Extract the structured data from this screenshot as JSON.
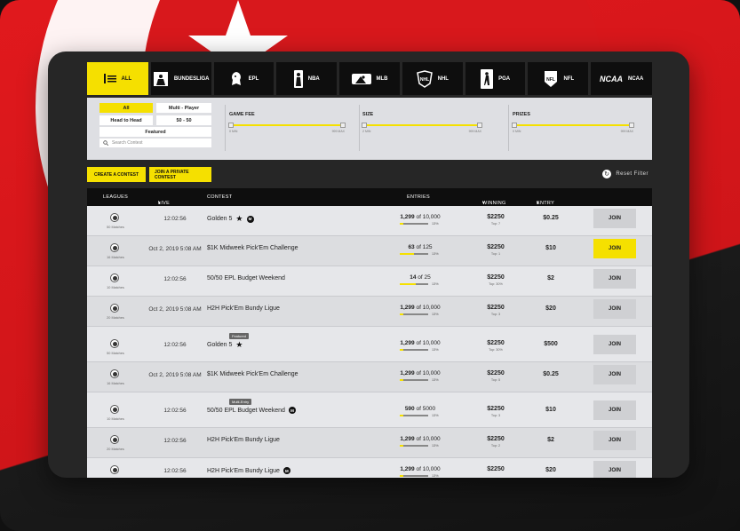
{
  "tabs": [
    {
      "label": "ALL",
      "active": true,
      "icon": "all-list-icon"
    },
    {
      "label": "BUNDESLIGA",
      "icon": "bundesliga-logo-icon"
    },
    {
      "label": "EPL",
      "icon": "epl-lion-icon"
    },
    {
      "label": "NBA",
      "icon": "nba-logo-icon"
    },
    {
      "label": "MLB",
      "icon": "mlb-logo-icon"
    },
    {
      "label": "NHL",
      "icon": "nhl-shield-icon"
    },
    {
      "label": "PGA",
      "icon": "pga-golfer-icon"
    },
    {
      "label": "NFL",
      "icon": "nfl-shield-icon"
    },
    {
      "label": "NCAA",
      "logo_text": "NCAA",
      "icon": "ncaa-logo-icon"
    }
  ],
  "filters": {
    "type_buttons": {
      "all": "All",
      "multi_player": "Multi - Player",
      "head_to_head": "Head to Head",
      "fifty_fifty": "50 - 50",
      "featured": "Featured"
    },
    "search_placeholder": "Search Contest",
    "game_fee": {
      "label": "GAME FEE",
      "lo": "0",
      "hi": "999",
      "lo_unit": "MIN",
      "hi_unit": "MAX",
      "range": [
        0,
        999
      ]
    },
    "size": {
      "label": "SIZE",
      "lo": "2",
      "hi": "999",
      "lo_unit": "MIN",
      "hi_unit": "MAX",
      "range": [
        2,
        999
      ]
    },
    "prizes": {
      "label": "PRIZES",
      "lo": "0",
      "hi": "999",
      "lo_unit": "MIN",
      "hi_unit": "MAX",
      "range": [
        0,
        999
      ]
    }
  },
  "actions": {
    "create": "CREATE A CONTEST",
    "private": "JOIN A PRIVATE CONTEST",
    "reset": "Reset Filter"
  },
  "columns": {
    "leagues": "LEAGUES",
    "live": "LIVE",
    "contest": "CONTEST",
    "entries": "ENTRIES",
    "winning": "WINNING",
    "entry_fee": "ENTRY FEE"
  },
  "rows": [
    {
      "matches": "50 Matches",
      "live": "12:02:56",
      "contest": "Golden 5",
      "star": true,
      "m": true,
      "entries_cur": "1,299",
      "entries_tot": "of 10,000",
      "pct": "13%",
      "fill": 0.13,
      "winning": "$2250",
      "top": "Top: 7",
      "fee": "$0.25",
      "join": "JOIN"
    },
    {
      "matches": "16 Matches",
      "live": "Oct 2, 2019 5:08 AM",
      "contest": "$1K Midweek Pick'Em Challenge",
      "entries_cur": "63",
      "entries_tot": "of 125",
      "pct": "13%",
      "fill": 0.5,
      "winning": "$2250",
      "top": "Top: 1",
      "fee": "$10",
      "join": "JOIN",
      "highlight": true
    },
    {
      "matches": "10 Matches",
      "live": "12:02:56",
      "contest": "50/50 EPL Budget Weekend",
      "entries_cur": "14",
      "entries_tot": "of 25",
      "pct": "13%",
      "fill": 0.56,
      "winning": "$2250",
      "top": "Top: 30%",
      "fee": "$2",
      "join": "JOIN"
    },
    {
      "matches": "20 Matches",
      "live": "Oct 2, 2019 5:08 AM",
      "contest": "H2H Pick'Em Bundy Ligue",
      "entries_cur": "1,299",
      "entries_tot": "of 10,000",
      "pct": "13%",
      "fill": 0.13,
      "winning": "$2250",
      "top": "Top: 3",
      "fee": "$20",
      "join": "JOIN"
    },
    {
      "matches": "50 Matches",
      "live": "12:02:56",
      "contest": "Golden 5",
      "star": true,
      "tag": "Featured",
      "entries_cur": "1,299",
      "entries_tot": "of 10,000",
      "pct": "13%",
      "fill": 0.13,
      "winning": "$2250",
      "top": "Top: 30%",
      "fee": "$500",
      "join": "JOIN"
    },
    {
      "matches": "16 Matches",
      "live": "Oct 2, 2019 5:08 AM",
      "contest": "$1K Midweek Pick'Em Challenge",
      "entries_cur": "1,299",
      "entries_tot": "of 10,000",
      "pct": "13%",
      "fill": 0.13,
      "winning": "$2250",
      "top": "Top: 5",
      "fee": "$0.25",
      "join": "JOIN"
    },
    {
      "matches": "10 Matches",
      "live": "12:02:56",
      "contest": "50/50 EPL Budget Weekend",
      "m": true,
      "tag": "Multi-Entry",
      "entries_cur": "590",
      "entries_tot": "of 5000",
      "pct": "13%",
      "fill": 0.12,
      "winning": "$2250",
      "top": "Top: 3",
      "fee": "$10",
      "join": "JOIN"
    },
    {
      "matches": "20 Matches",
      "live": "12:02:56",
      "contest": "H2H Pick'Em Bundy Ligue",
      "entries_cur": "1,299",
      "entries_tot": "of 10,000",
      "pct": "13%",
      "fill": 0.13,
      "winning": "$2250",
      "top": "Top: 2",
      "fee": "$2",
      "join": "JOIN"
    },
    {
      "matches": "",
      "live": "12:02:56",
      "contest": "H2H Pick'Em Bundy Ligue",
      "m": true,
      "entries_cur": "1,299",
      "entries_tot": "of 10,000",
      "pct": "13%",
      "fill": 0.13,
      "winning": "$2250",
      "top": "",
      "fee": "$20",
      "join": "JOIN"
    }
  ]
}
